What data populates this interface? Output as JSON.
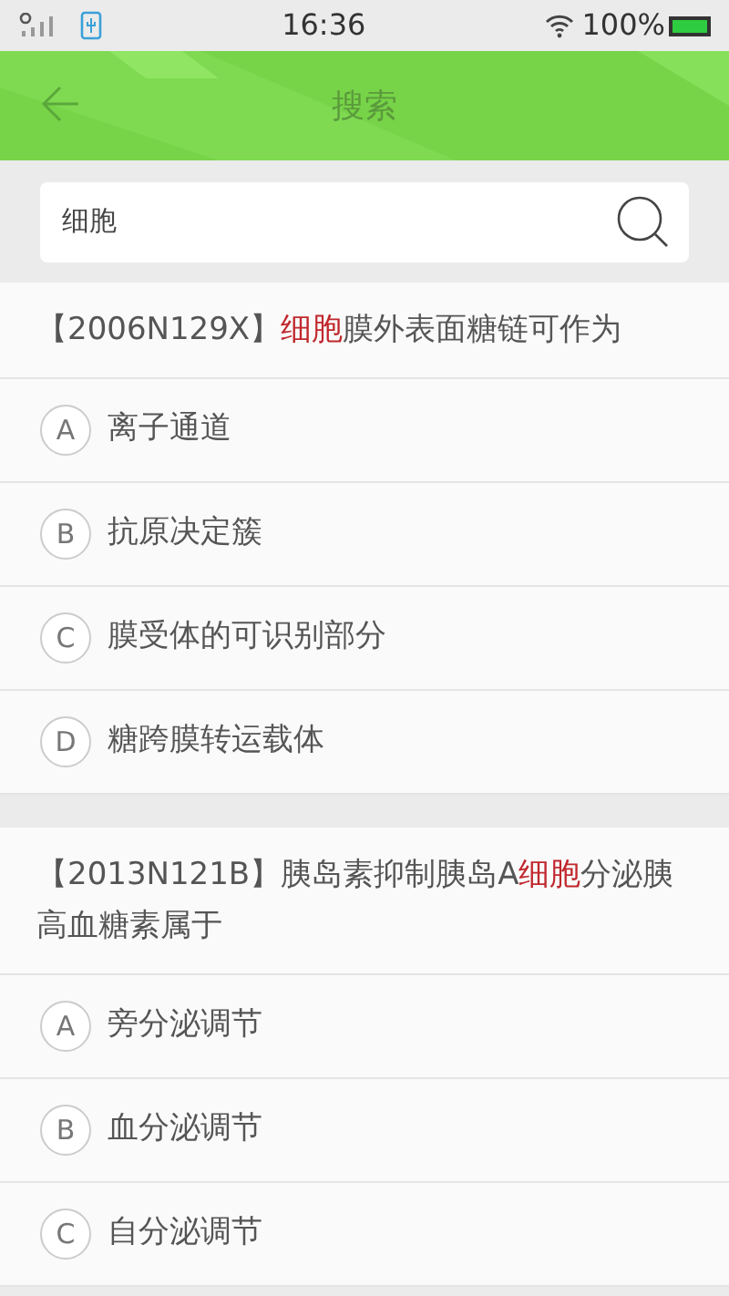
{
  "status_bar": {
    "time": "16:36",
    "battery": "100%"
  },
  "header": {
    "title": "搜索"
  },
  "search": {
    "value": "细胞"
  },
  "questions": [
    {
      "parts": [
        {
          "text": "【2006N129X】",
          "highlight": false
        },
        {
          "text": "细胞",
          "highlight": true
        },
        {
          "text": "膜外表面糖链可作为",
          "highlight": false
        }
      ],
      "options": [
        {
          "letter": "A",
          "text": "离子通道"
        },
        {
          "letter": "B",
          "text": "抗原决定簇"
        },
        {
          "letter": "C",
          "text": "膜受体的可识别部分"
        },
        {
          "letter": "D",
          "text": "糖跨膜转运载体"
        }
      ]
    },
    {
      "parts": [
        {
          "text": "【2013N121B】胰岛素抑制胰岛A",
          "highlight": false
        },
        {
          "text": "细胞",
          "highlight": true
        },
        {
          "text": "分泌胰高血糖素属于",
          "highlight": false
        }
      ],
      "options": [
        {
          "letter": "A",
          "text": "旁分泌调节"
        },
        {
          "letter": "B",
          "text": "血分泌调节"
        },
        {
          "letter": "C",
          "text": "自分泌调节"
        }
      ]
    }
  ]
}
